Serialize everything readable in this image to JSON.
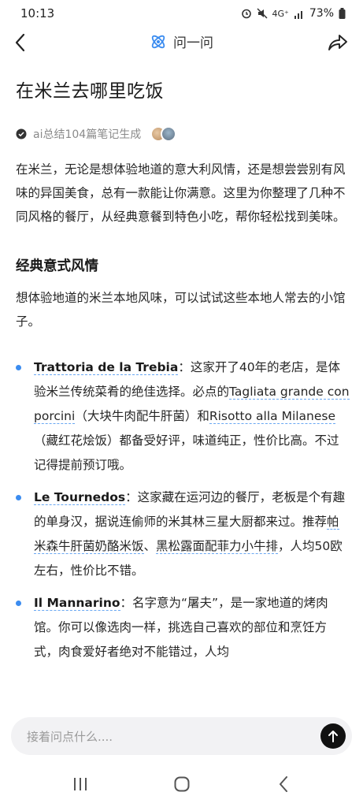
{
  "status_bar": {
    "time": "10:13",
    "icons": [
      "alarm-icon",
      "mute-icon",
      "network-4g-icon",
      "signal-icon",
      "battery-icon"
    ],
    "network": "4G⁺",
    "battery": "73%"
  },
  "nav": {
    "title": "问一问",
    "accent": "#3b8cf0"
  },
  "article": {
    "title": "在米兰去哪里吃饭",
    "meta": "ai总结104篇笔记生成",
    "intro": "在米兰，无论是想体验地道的意大利风情，还是想尝尝别有风味的异国美食，总有一款能让你满意。这里为你整理了几种不同风格的餐厅，从经典意餐到特色小吃，帮你轻松找到美味。",
    "section": {
      "heading": "经典意式风情",
      "intro": "想体验地道的米兰本地风味，可以试试这些本地人常去的小馆子。",
      "items": [
        {
          "name": "Trattoria de la Trebia",
          "t1": "：这家开了40年的老店，是体验米兰传统菜肴的绝佳选择。必点的",
          "dish1": "Tagliata grande con porcini",
          "t2": "（大块牛肉配牛肝菌）和",
          "dish2": "Risotto alla Milanese",
          "t3": "（藏红花烩饭）都备受好评，味道纯正，性价比高。不过记得提前预订哦。"
        },
        {
          "name": "Le Tournedos",
          "t1": "：这家藏在运河边的餐厅，老板是个有趣的单身汉，据说连偷师的米其林三星大厨都来过。推荐",
          "dish1": "帕米森牛肝菌奶酪米饭",
          "t2": "、",
          "dish2": "黑松露面配菲力小牛排",
          "t3": "，人均50欧左右，性价比不错。"
        },
        {
          "name": "Il Mannarino",
          "t1": "：名字意为“屠夫”，是一家地道的烤肉馆。你可以像选肉一样，挑选自己喜欢的部位和烹饪方式，肉食爱好者绝对不能错过，人均"
        }
      ]
    }
  },
  "input": {
    "placeholder": "接着问点什么...."
  }
}
